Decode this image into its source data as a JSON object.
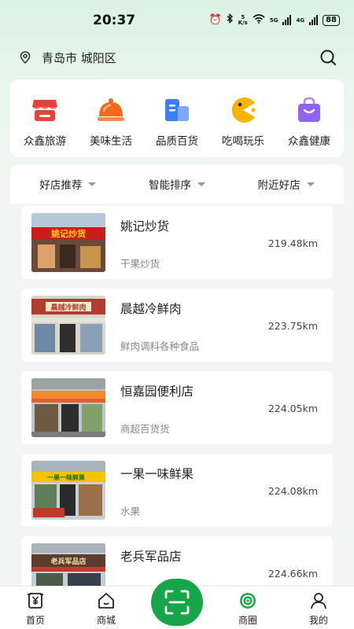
{
  "status_bar": {
    "time": "20:37",
    "speed_value": "5",
    "speed_unit": "K/s",
    "network_1": "5G",
    "network_2": "4G",
    "battery": "88"
  },
  "location": {
    "city": "青岛市",
    "district": "城阳区"
  },
  "categories": [
    {
      "label": "众鑫旅游",
      "icon": "store-awning-icon",
      "color": "#e8413a"
    },
    {
      "label": "美味生活",
      "icon": "cloche-icon",
      "color": "#f26b1d"
    },
    {
      "label": "品质百货",
      "icon": "buildings-icon",
      "color": "#3d7ff2"
    },
    {
      "label": "吃喝玩乐",
      "icon": "pacman-icon",
      "color": "#f6b300"
    },
    {
      "label": "众鑫健康",
      "icon": "shopping-bag-icon",
      "color": "#8e64f0"
    }
  ],
  "filters": [
    {
      "label": "好店推荐"
    },
    {
      "label": "智能排序"
    },
    {
      "label": "附近好店"
    }
  ],
  "stores": [
    {
      "name": "姚记炒货",
      "distance": "219.48km",
      "category": "干果炒货",
      "sign_text": "姚记炒货"
    },
    {
      "name": "晨越冷鲜肉",
      "distance": "223.75km",
      "category": "鲜肉调料各种食品",
      "sign_text": "晨越冷鲜肉"
    },
    {
      "name": "恒嘉园便利店",
      "distance": "224.05km",
      "category": "商超百货货",
      "sign_text": ""
    },
    {
      "name": "一果一味鲜果",
      "distance": "224.08km",
      "category": "水果",
      "sign_text": "一果一味鲜果"
    },
    {
      "name": "老兵军品店",
      "distance": "224.66km",
      "category": "",
      "sign_text": "老兵军品店"
    }
  ],
  "tabs": [
    {
      "label": "首页",
      "icon": "yuan-home-icon"
    },
    {
      "label": "商城",
      "icon": "house-icon"
    },
    {
      "label": "",
      "icon": "scan-icon"
    },
    {
      "label": "商圈",
      "icon": "circle-target-icon"
    },
    {
      "label": "我的",
      "icon": "person-icon"
    }
  ],
  "colors": {
    "accent_green": "#16a548",
    "background_top": "#d9f2e3"
  }
}
